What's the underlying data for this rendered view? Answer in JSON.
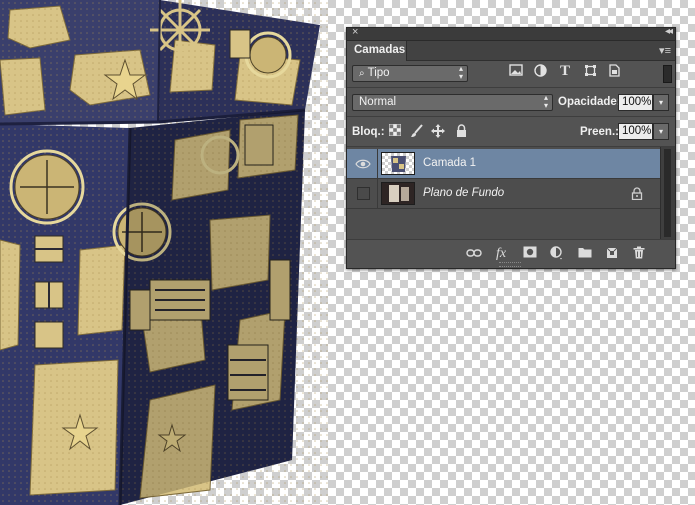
{
  "canvas": {
    "artwork": "patterned-storage-box-photo",
    "colors": {
      "navy": "#2f3563",
      "parchment": "#d8c487",
      "ink": "#3a3426"
    }
  },
  "panel": {
    "close_glyph": "×",
    "collapse_glyph": "«",
    "tab_label": "Camadas",
    "menu_glyph": "≡",
    "filter": {
      "type_label": "Tipo",
      "icons": [
        "image-filter-icon",
        "adjustment-filter-icon",
        "type-filter-icon",
        "shape-filter-icon",
        "smart-object-filter-icon"
      ]
    },
    "blend_mode": "Normal",
    "opacity_label": "Opacidade:",
    "opacity_value": "100%",
    "lock_label": "Bloq.:",
    "fill_label": "Preen.:",
    "fill_value": "100%",
    "layers": [
      {
        "name": "Camada 1",
        "visible": true,
        "selected": true,
        "locked": false
      },
      {
        "name": "Plano de Fundo",
        "visible": false,
        "selected": false,
        "locked": true
      }
    ],
    "footer_icons": [
      "link-layers-icon",
      "fx-icon",
      "add-mask-icon",
      "adjustment-layer-icon",
      "new-group-icon",
      "new-layer-icon",
      "delete-layer-icon"
    ],
    "footer_fx": "fx",
    "selected_color": "#6e86a3"
  }
}
